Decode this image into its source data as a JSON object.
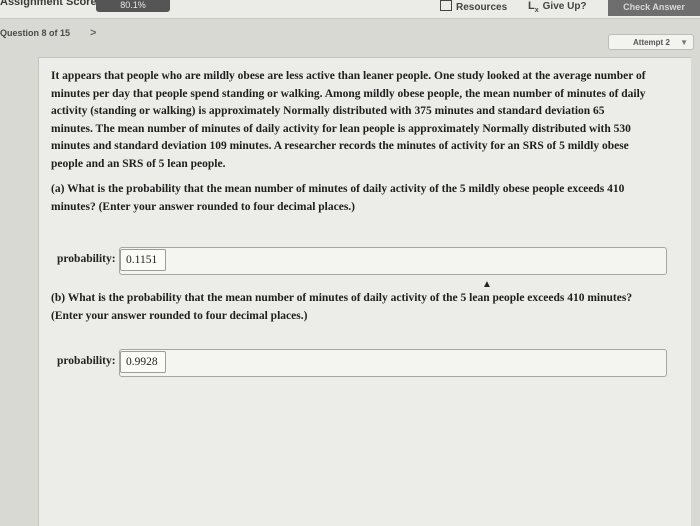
{
  "header": {
    "score_label": "Assignment Score:",
    "score_value": "80.1%",
    "resources_label": "Resources",
    "give_up_label": "Give Up?",
    "check_answer_label": "Check Answer"
  },
  "navigation": {
    "question_position": "Question 8 of 15",
    "next_symbol": ">",
    "attempt_label": "Attempt 2"
  },
  "question": {
    "passage": "It appears that people who are mildly obese are less active than leaner people. One study looked at the average number of minutes per day that people spend standing or walking. Among mildly obese people, the mean number of minutes of daily activity (standing or walking) is approximately Normally distributed with 375 minutes and standard deviation 65 minutes. The mean number of minutes of daily activity for lean people is approximately Normally distributed with 530 minutes and standard deviation 109 minutes. A researcher records the minutes of activity for an SRS of 5 mildly obese people and an SRS of 5 lean people.",
    "part_a": "(a) What is the probability that the mean number of minutes of daily activity of the 5 mildly obese people exceeds 410 minutes? (Enter your answer rounded to four decimal places.)",
    "part_a_label": "probability:",
    "part_a_value": "0.1151",
    "part_b": "(b) What is the probability that the mean number of minutes of daily activity of the 5 lean people exceeds 410 minutes? (Enter your answer rounded to four decimal places.)",
    "part_b_label": "probability:",
    "part_b_value": "0.9928"
  },
  "icons": {
    "resources": "book-icon",
    "give_up": "lx-icon",
    "attempt_caret": "chevron-down-icon"
  }
}
